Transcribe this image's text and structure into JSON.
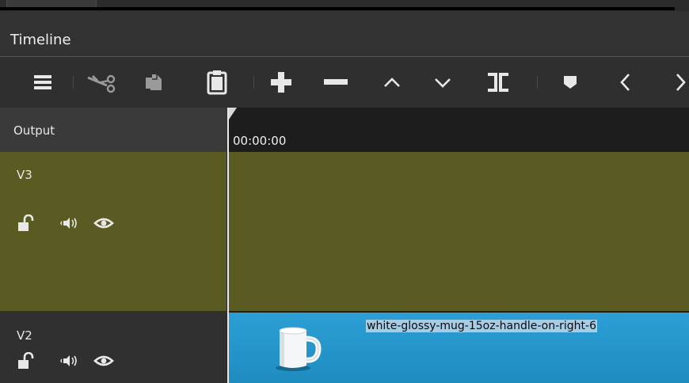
{
  "panel": {
    "title": "Timeline"
  },
  "toolbar": {
    "buttons": [
      {
        "name": "menu",
        "icon": "hamburger-menu-icon"
      },
      {
        "name": "cut",
        "icon": "scissors-icon"
      },
      {
        "name": "copy",
        "icon": "copy-icon"
      },
      {
        "name": "paste",
        "icon": "clipboard-icon"
      },
      {
        "name": "append",
        "icon": "plus-icon"
      },
      {
        "name": "remove",
        "icon": "minus-icon"
      },
      {
        "name": "lift",
        "icon": "chevron-up-icon"
      },
      {
        "name": "overwrite",
        "icon": "chevron-down-icon"
      },
      {
        "name": "split",
        "icon": "split-icon"
      },
      {
        "name": "marker",
        "icon": "marker-icon"
      },
      {
        "name": "previous",
        "icon": "chevron-left-icon"
      },
      {
        "name": "next",
        "icon": "chevron-right-icon"
      }
    ]
  },
  "ruler": {
    "output_label": "Output",
    "timecode": "00:00:00"
  },
  "tracks": [
    {
      "name": "V3",
      "color": "#5a5a23"
    },
    {
      "name": "V2",
      "color": "#303030"
    }
  ],
  "clips": [
    {
      "track": "V2",
      "label": "white-glossy-mug-15oz-handle-on-right-6",
      "color": "#2c9fd4",
      "thumbnail": "mug-thumbnail"
    }
  ],
  "colors": {
    "toolbar_icon": "#e8e8e8",
    "playhead": "#e9e9e9",
    "track_v3": "#5a5a23",
    "clip": "#2c9fd4"
  }
}
